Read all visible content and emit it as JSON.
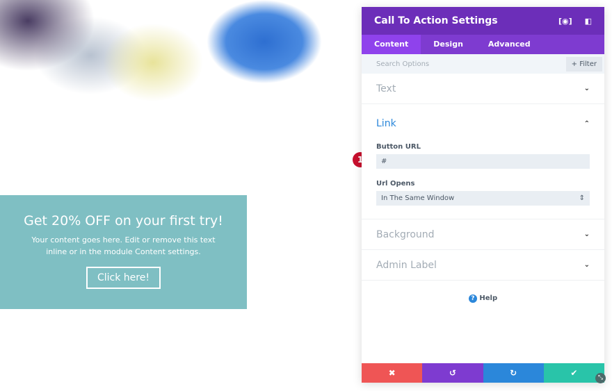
{
  "cta": {
    "title": "Get 20% OFF on your first try!",
    "body": "Your content goes here. Edit or remove this text inline or in the module Content settings.",
    "button": "Click here!"
  },
  "panel": {
    "title": "Call To Action Settings",
    "tabs": [
      "Content",
      "Design",
      "Advanced"
    ],
    "search_placeholder": "Search Options",
    "filter": "+ Filter",
    "sections": {
      "text": "Text",
      "link": "Link",
      "background": "Background",
      "admin_label": "Admin Label"
    },
    "button_url_label": "Button URL",
    "button_url_value": "#",
    "url_opens_label": "Url Opens",
    "url_opens_value": "In The Same Window",
    "help": "Help"
  },
  "badge": "1",
  "colors": {
    "header": "#6c2eb9",
    "tabs": "#7e3bd0",
    "cancel": "#ef5555",
    "undo": "#7e3bd0",
    "redo": "#2b87da",
    "save": "#29c4a9",
    "cta_bg": "#7fbfc3"
  }
}
